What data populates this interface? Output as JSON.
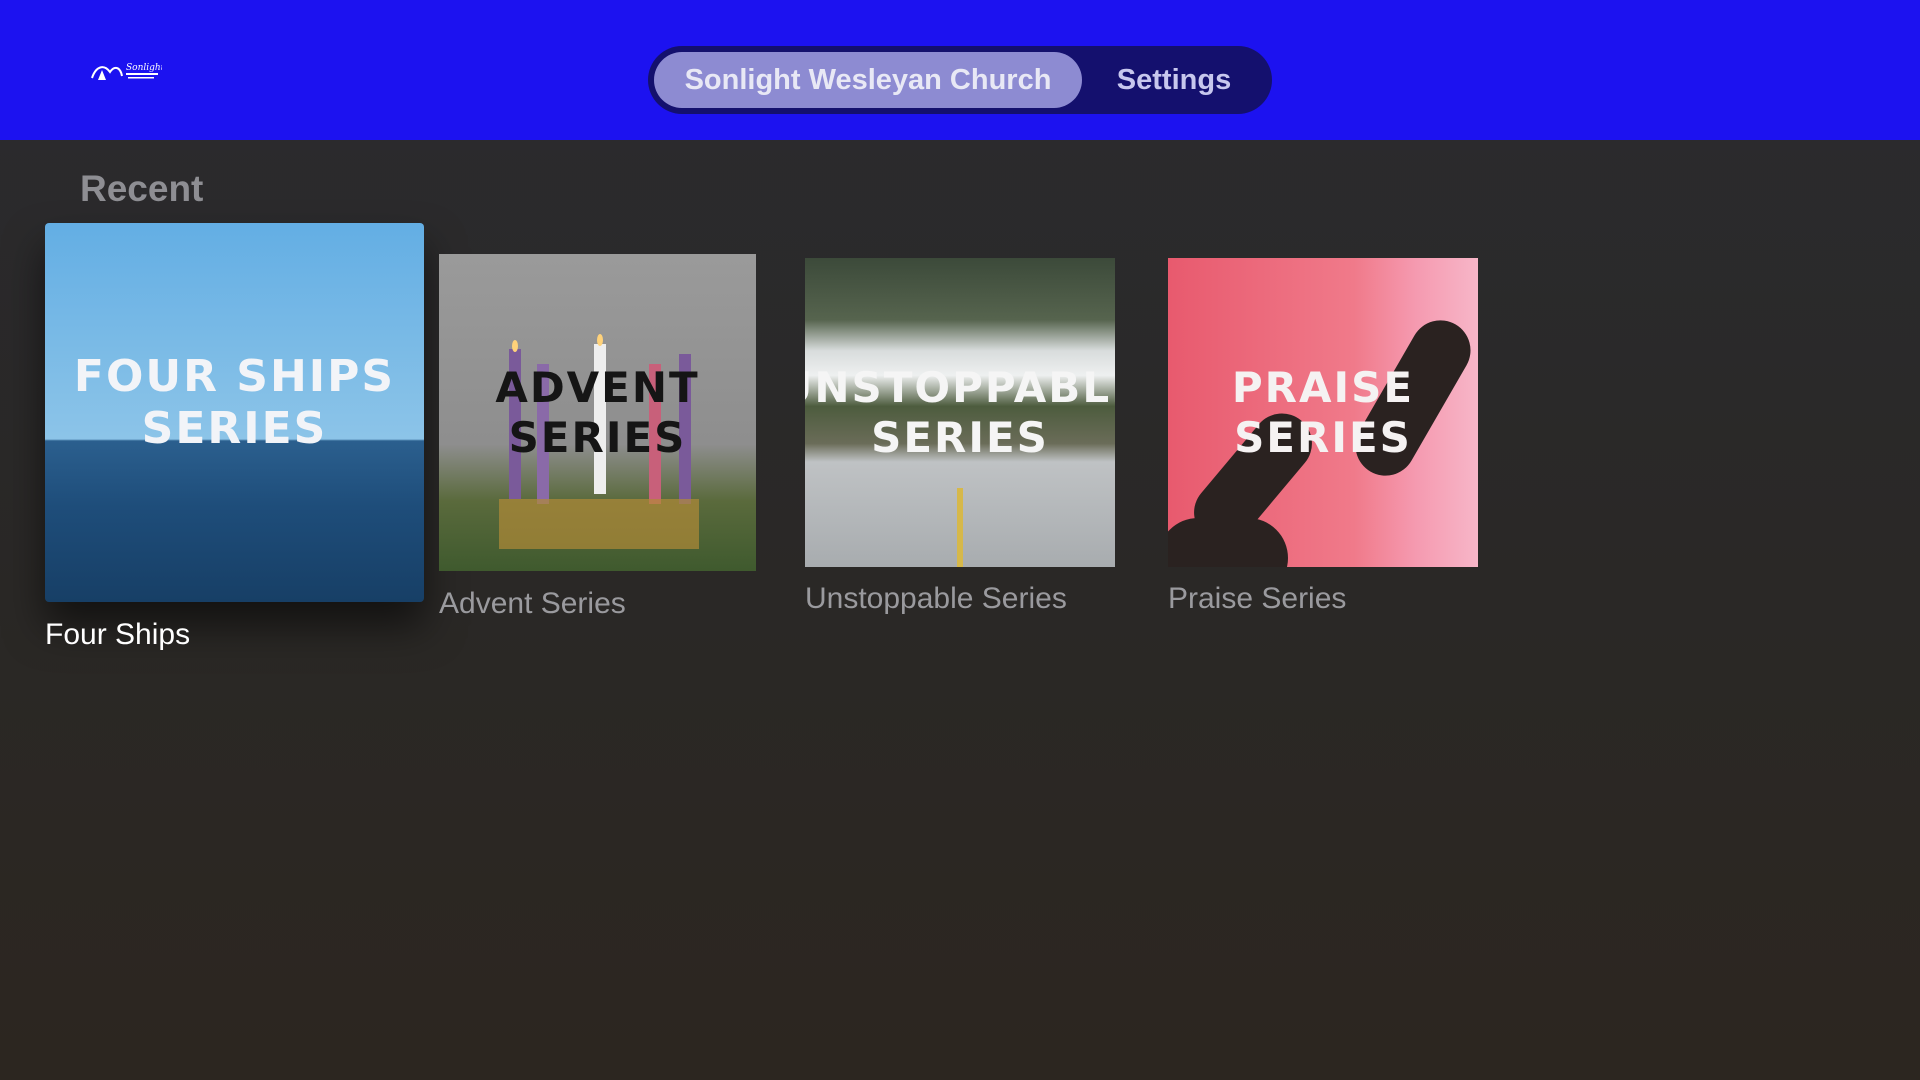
{
  "header": {
    "logo_text": "Sonlight Wesleyan Church",
    "tabs": [
      {
        "label": "Sonlight Wesleyan Church",
        "active": true
      },
      {
        "label": "Settings",
        "active": false
      }
    ]
  },
  "section": {
    "title": "Recent"
  },
  "cards": [
    {
      "art_line1": "FOUR SHIPS",
      "art_line2": "SERIES",
      "caption": "Four Ships",
      "focused": true
    },
    {
      "art_line1": "ADVENT",
      "art_line2": "SERIES",
      "caption": "Advent Series",
      "focused": false
    },
    {
      "art_line1": "UNSTOPPABLE",
      "art_line2": "SERIES",
      "caption": "Unstoppable Series",
      "focused": false
    },
    {
      "art_line1": "PRAISE",
      "art_line2": "SERIES",
      "caption": "Praise Series",
      "focused": false
    }
  ],
  "colors": {
    "topbar": "#1c12f0",
    "tabbar": "#14106e",
    "active_tab": "#8d8bd2",
    "background": "#2a2826"
  }
}
